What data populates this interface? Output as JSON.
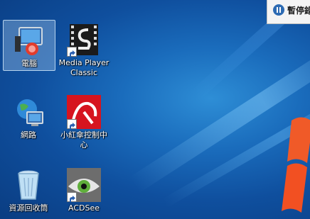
{
  "desktop_icons": [
    {
      "label": "電腦"
    },
    {
      "label": "Media Player Classic"
    },
    {
      "label": "網路"
    },
    {
      "label": "小紅傘控制中心"
    },
    {
      "label": "資源回收筒"
    },
    {
      "label": "ACDSee"
    }
  ],
  "toolbar": {
    "pause_label": "暫停錄"
  },
  "colors": {
    "desktop_blue": "#1a6cbc",
    "avira_red": "#d6141f"
  }
}
